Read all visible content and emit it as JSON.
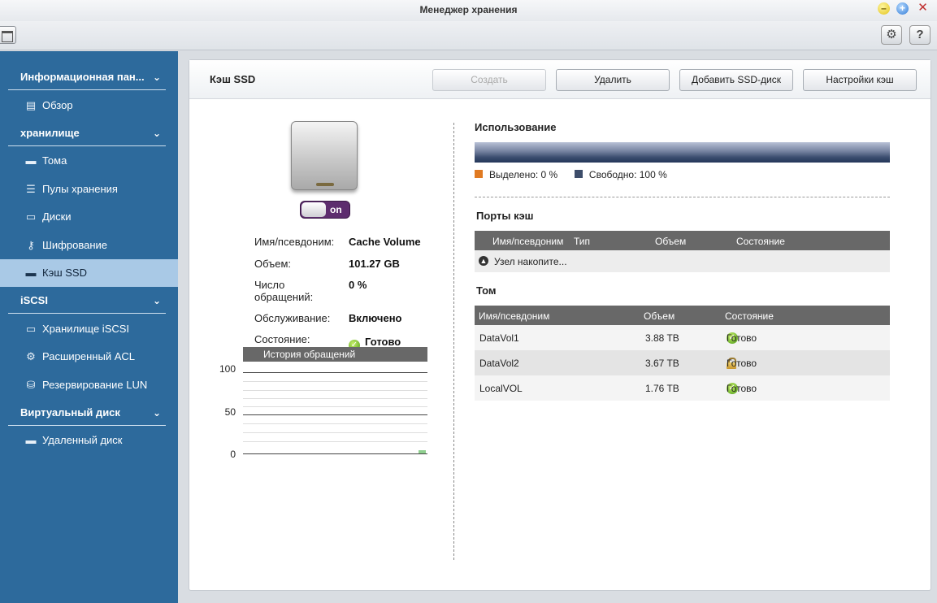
{
  "window": {
    "title": "Менеджер хранения"
  },
  "sidebar": {
    "sections": [
      {
        "label": "Информационная пан..."
      },
      {
        "label": "хранилище"
      },
      {
        "label": "iSCSI"
      },
      {
        "label": "Виртуальный диск"
      }
    ],
    "items": [
      {
        "label": "Обзор",
        "icon": "overview-icon"
      },
      {
        "label": "Тома",
        "icon": "volume-icon"
      },
      {
        "label": "Пулы хранения",
        "icon": "storage-pool-icon"
      },
      {
        "label": "Диски",
        "icon": "disk-icon"
      },
      {
        "label": "Шифрование",
        "icon": "key-icon"
      },
      {
        "label": "Кэш SSD",
        "icon": "ssd-icon"
      },
      {
        "label": "Хранилище iSCSI",
        "icon": "iscsi-storage-icon"
      },
      {
        "label": "Расширенный ACL",
        "icon": "gear-icon"
      },
      {
        "label": "Резервирование LUN",
        "icon": "lun-backup-icon"
      },
      {
        "label": "Удаленный диск",
        "icon": "remote-disk-icon"
      }
    ]
  },
  "main": {
    "title": "Кэш SSD",
    "buttons": {
      "create": "Создать",
      "delete": "Удалить",
      "add_ssd": "Добавить SSD-диск",
      "settings": "Настройки кэш"
    },
    "toggle_label": "on",
    "details": {
      "alias_label": "Имя/псевдоним:",
      "alias_value": "Cache Volume",
      "size_label": "Объем:",
      "size_value": "101.27 GB",
      "hits_label_1": "Число",
      "hits_label_2": "обращений:",
      "hits_value": "0 %",
      "service_label": "Обслуживание:",
      "service_value": "Включено",
      "state_label": "Состояние:",
      "state_value": "Готово"
    },
    "history": {
      "title": "История обращений",
      "y_ticks": [
        "100",
        "50",
        "0"
      ]
    },
    "usage": {
      "title": "Использование",
      "allocated_label": "Выделено: 0 %",
      "free_label": "Свободно: 100 %",
      "allocated_percent": 0,
      "free_percent": 100,
      "allocated_color": "#e07a22",
      "free_color": "#3d4d6a"
    },
    "cache_ports": {
      "title": "Порты кэш",
      "columns": [
        "Имя/псевдоним",
        "Тип",
        "Объем",
        "Состояние"
      ],
      "rows": [
        {
          "name": "Узел накопите..."
        }
      ]
    },
    "volumes": {
      "title": "Том",
      "columns": [
        "Имя/псевдоним",
        "Объем",
        "Состояние"
      ],
      "rows": [
        {
          "name": "DataVol1",
          "size": "3.88 TB",
          "status": "Готово",
          "status_icon": "check-icon"
        },
        {
          "name": "DataVol2",
          "size": "3.67 TB",
          "status": "Готово",
          "status_icon": "lock-icon"
        },
        {
          "name": "LocalVOL",
          "size": "1.76 TB",
          "status": "Готово",
          "status_icon": "check-icon"
        }
      ]
    }
  }
}
